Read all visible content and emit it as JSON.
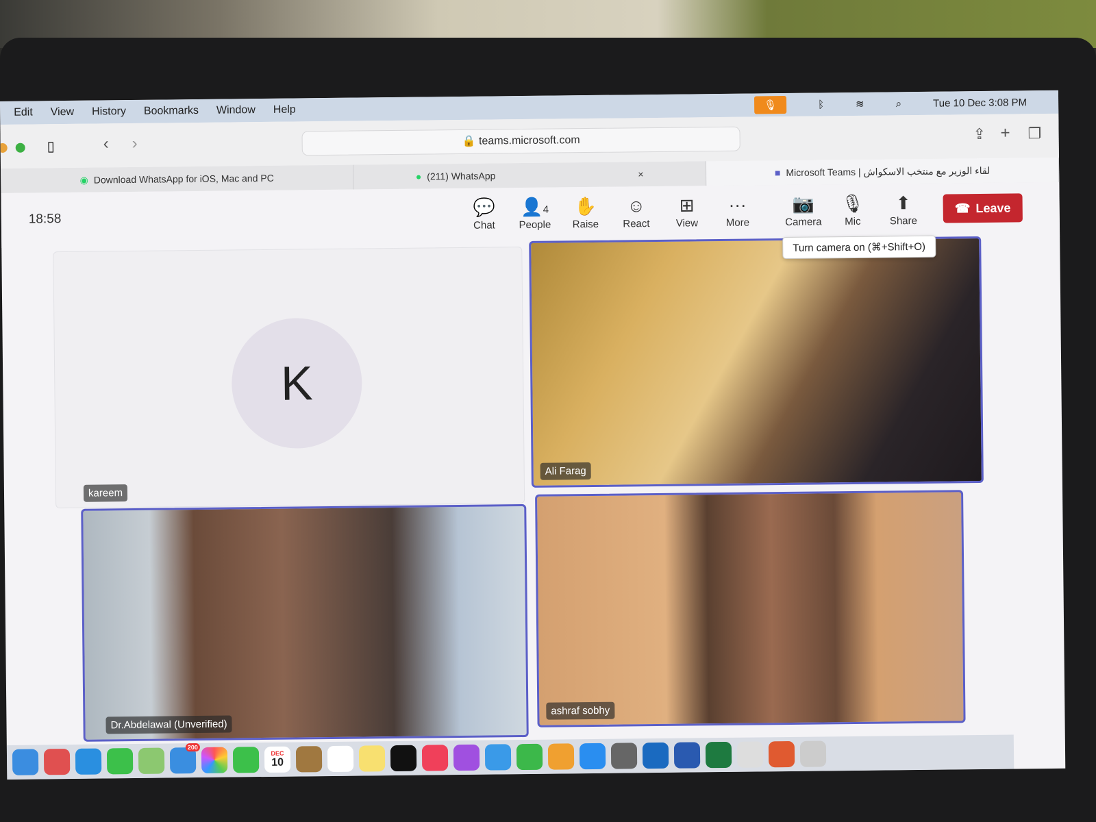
{
  "menubar": {
    "items": [
      "Edit",
      "View",
      "History",
      "Bookmarks",
      "Window",
      "Help"
    ],
    "datetime": "Tue 10 Dec  3:08 PM",
    "status_icons": [
      "mic-icon",
      "stage-manager-icon",
      "bluetooth-icon",
      "airdrop-icon",
      "briefcase-icon",
      "play-icon",
      "input-a-icon",
      "battery-icon",
      "wifi-icon",
      "search-icon",
      "control-center-icon",
      "siri-icon"
    ]
  },
  "browser": {
    "url": "teams.microsoft.com",
    "tabs": [
      {
        "label": "Download WhatsApp for iOS, Mac and PC"
      },
      {
        "label": "(211) WhatsApp"
      },
      {
        "label": "Microsoft Teams | لقاء الوزير مع منتخب الاسكواش"
      }
    ]
  },
  "meeting": {
    "timer": "18:58",
    "controls": [
      {
        "label": "Chat",
        "icon": "💬"
      },
      {
        "label": "People",
        "icon": "👤",
        "count": "4"
      },
      {
        "label": "Raise",
        "icon": "✋"
      },
      {
        "label": "React",
        "icon": "☺"
      },
      {
        "label": "View",
        "icon": "⊞"
      },
      {
        "label": "More",
        "icon": "···"
      },
      {
        "label": "Camera",
        "icon": "📷"
      },
      {
        "label": "Mic",
        "icon": "🎙"
      },
      {
        "label": "Share",
        "icon": "⬆"
      }
    ],
    "leave_label": "Leave",
    "tooltip": "Turn camera on (⌘+Shift+O)",
    "participants": [
      {
        "name": "kareem",
        "initial": "K"
      },
      {
        "name": "Ali Farag"
      },
      {
        "name": "Dr.Abdelawal (Unverified)"
      },
      {
        "name": "ashraf sobhy"
      }
    ],
    "accent": "#5b5fc7",
    "leave_color": "#c4262e"
  },
  "dock": {
    "mail_badge": "200",
    "calendar_month": "DEC",
    "calendar_day": "10"
  }
}
